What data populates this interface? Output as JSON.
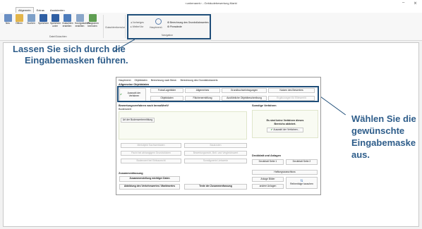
{
  "window": {
    "title": "<unbenannt> - Gebäudebewertung Markt",
    "minimize": "–",
    "close": "⨯"
  },
  "menu_tabs": [
    "Allgemein",
    "Extras",
    "Assistenten"
  ],
  "ribbon": {
    "buttons": [
      {
        "label": "Neu",
        "color": "#6a8fc4"
      },
      {
        "label": "Öffnen",
        "color": "#e3b54a"
      },
      {
        "label": "Suchen",
        "color": "#7ea0c8"
      },
      {
        "label": "Speichern",
        "color": "#2f5fa3"
      },
      {
        "label": "Speichern unter",
        "color": "#2f5fa3"
      },
      {
        "label": "Gutachten erstellen",
        "color": "#4d7cbb"
      },
      {
        "label": "Kurzgutachten erstellen",
        "color": "#8aa6c9"
      },
      {
        "label": "Programm beenden",
        "color": "#5f9e52"
      }
    ],
    "group_datei": "Datei/Gutachten",
    "gutachtenformular": "Gutachtenformular",
    "group_nav": "Navigation",
    "nav_left": [
      "Vorheriges",
      "Weiter/Vor"
    ],
    "nav_mid": "Hauptmenü",
    "nav_right": [
      "Berechnung des Grundstückswertes",
      "Pinnwände"
    ]
  },
  "callouts": {
    "left": [
      "Lassen Sie sich durch die",
      "Eingabemasken führen."
    ],
    "right": [
      "Wählen Sie die",
      "gewünschte",
      "Eingabemaske aus."
    ]
  },
  "dialog": {
    "tabs": [
      "Hauptmenü",
      "Objektdaten",
      "Berechnung nach Bewe.",
      "Berechnung des Grundstückswerts"
    ],
    "section_allgemein": "Allgemeine Objektdaten",
    "auswahl": "Auswahl der Verfahren",
    "row1": [
      "Fotos/Lagebilder",
      "Allgemeines",
      "Grundbuchseintragungen",
      "Nutzen des Bewerters"
    ],
    "row2": [
      "Objektdaten",
      "Flächenermittlung",
      "Ausführliche Objektbeschreibung",
      "Ergänzungen für Elitewert/it"
    ],
    "section_verfahren": "Bewertungsverfahren nach ImmoWertV",
    "bodenwert": "Bodenwert",
    "bodenwert_btn": "Art der Bodenwertermittlung",
    "grid": [
      "Mietobjekt Sachwertdaten",
      "Baukosten",
      "Pacht bei abhangigem Grundstücken",
      "Bewertungsrecht, Bell. und Vergleichswert",
      "Bodenwert bei Erbbaurecht",
      "Sonstigwerte Liebwerte"
    ],
    "section_sonstige": "Sonstige Verfahren",
    "sonstige_text": [
      "Es sind keine Verfahren dieses",
      "Bereichs aktiviert."
    ],
    "sonstige_btn": "Auswahl der Verfahren...",
    "section_deckblatt": "Deckblatt und Anlagen",
    "deckblatt1": "Deckblatt Seite 1",
    "deckblatt2": "Deckblatt Seite 2",
    "haftung": "Haftungsausschluss",
    "anlage_bilder": "Anlage Bilder",
    "andere_anlagen": "andere Anlagen",
    "reihenfolge": "Reihenfolge tauschen",
    "section_zusammen": "Zusammenfassung",
    "zusammen_btn": "Zusammenstellung wichtiger Daten",
    "abbildung_btn": "Abbildung des Verkehrswertes / Marktwertes",
    "texte_btn": "Texte der Zusammenfassung"
  }
}
